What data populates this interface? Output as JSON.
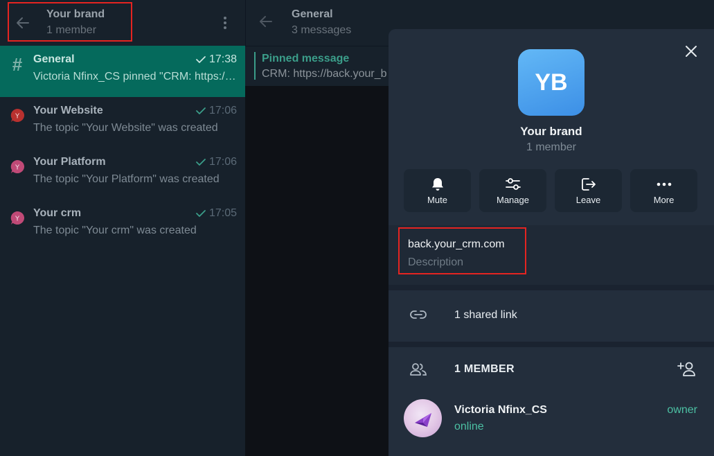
{
  "sidebar": {
    "header": {
      "title": "Your brand",
      "subtitle": "1 member"
    },
    "topics": [
      {
        "name": "General",
        "time": "17:38",
        "preview": "Victoria Nfinx_CS pinned \"CRM: https://back.your_crm.com\"",
        "icon": "hash-icon",
        "active": true
      },
      {
        "name": "Your Website",
        "time": "17:06",
        "preview": "The topic \"Your Website\" was created",
        "icon": "topic-icon",
        "color": "#b8312f"
      },
      {
        "name": "Your Platform",
        "time": "17:06",
        "preview": "The topic \"Your Platform\" was created",
        "icon": "topic-icon",
        "color": "#c04a77"
      },
      {
        "name": "Your crm",
        "time": "17:05",
        "preview": "The topic \"Your crm\" was created",
        "icon": "topic-icon",
        "color": "#c04a77"
      }
    ]
  },
  "chat": {
    "title": "General",
    "subtitle": "3 messages",
    "pinned": {
      "title": "Pinned message",
      "text": "CRM: https://back.your_b"
    }
  },
  "info": {
    "avatar_initials": "YB",
    "name": "Your brand",
    "subtitle": "1 member",
    "actions": [
      {
        "label": "Mute",
        "icon": "bell-icon"
      },
      {
        "label": "Manage",
        "icon": "sliders-icon"
      },
      {
        "label": "Leave",
        "icon": "leave-icon"
      },
      {
        "label": "More",
        "icon": "more-icon"
      }
    ],
    "description": {
      "value": "back.your_crm.com",
      "label": "Description"
    },
    "shared_link": "1 shared link",
    "members_header": "1 MEMBER",
    "members": [
      {
        "name": "Victoria Nfinx_CS",
        "status": "online",
        "role": "owner"
      }
    ]
  },
  "colors": {
    "accent": "#056a5c",
    "highlight": "#e52421",
    "online": "#4cc0a3"
  }
}
